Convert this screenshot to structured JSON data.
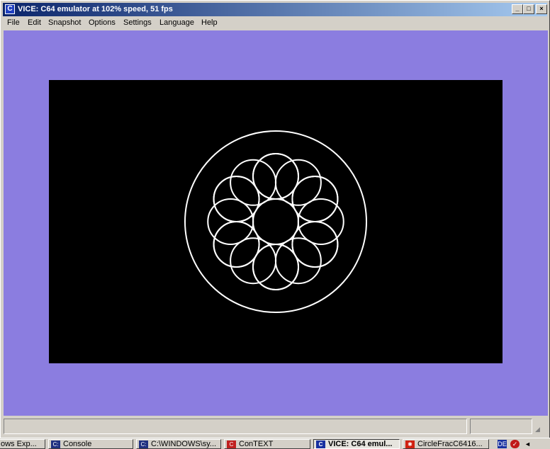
{
  "window": {
    "title": "VICE: C64 emulator at 102% speed, 51 fps",
    "icon": "c64-icon",
    "controls": {
      "minimize": "_",
      "maximize": "□",
      "close": "×"
    }
  },
  "menubar": {
    "items": [
      "File",
      "Edit",
      "Snapshot",
      "Options",
      "Settings",
      "Language",
      "Help"
    ]
  },
  "screen": {
    "border_color": "#8b7de0",
    "display_color": "#000000",
    "drawing_color": "#ffffff",
    "drawing": "circle-fractal"
  },
  "taskbar": {
    "items": [
      {
        "label": "ows Exp...",
        "icon": "folder-icon"
      },
      {
        "label": "Console",
        "icon": "console-icon"
      },
      {
        "label": "C:\\WINDOWS\\sy...",
        "icon": "cmd-icon"
      },
      {
        "label": "ConTEXT",
        "icon": "context-editor-icon"
      },
      {
        "label": "VICE: C64 emul...",
        "icon": "vice-icon",
        "active": true
      },
      {
        "label": "CircleFracC6416...",
        "icon": "paint-icon"
      }
    ],
    "tray": [
      "de-language-icon",
      "network-icon",
      "speaker-icon"
    ],
    "tray_label": "DE"
  }
}
